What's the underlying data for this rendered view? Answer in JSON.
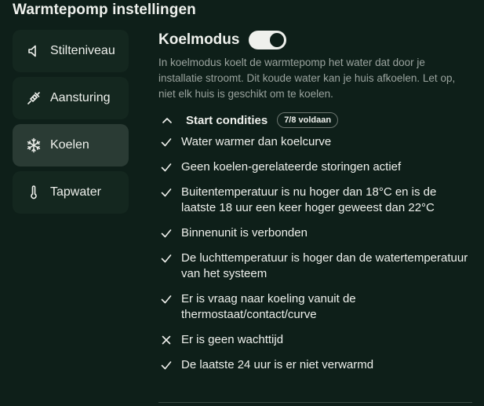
{
  "page": {
    "title": "Warmtepomp instellingen"
  },
  "sidebar": {
    "items": [
      {
        "label": "Stilteniveau",
        "icon": "speaker-icon",
        "active": false
      },
      {
        "label": "Aansturing",
        "icon": "plug-icon",
        "active": false
      },
      {
        "label": "Koelen",
        "icon": "snowflake-icon",
        "active": true
      },
      {
        "label": "Tapwater",
        "icon": "thermometer-icon",
        "active": false
      }
    ]
  },
  "mode": {
    "title": "Koelmodus",
    "toggle_on": true,
    "description": "In koelmodus koelt de warmtepomp het water dat door je installatie stroomt. Dit koude water kan je huis afkoelen. Let op, niet elk huis is geschikt om te koelen."
  },
  "conditions": {
    "title": "Start condities",
    "badge": "7/8 voldaan",
    "expanded": true,
    "items": [
      {
        "text": "Water warmer dan koelcurve",
        "met": true
      },
      {
        "text": "Geen koelen-gerelateerde storingen actief",
        "met": true
      },
      {
        "text": "Buitentemperatuur is nu hoger dan 18°C en is de laatste 18 uur een keer hoger geweest dan 22°C",
        "met": true
      },
      {
        "text": "Binnenunit is verbonden",
        "met": true
      },
      {
        "text": "De luchttemperatuur is hoger dan de watertemperatuur van het systeem",
        "met": true
      },
      {
        "text": "Er is vraag naar koeling vanuit de thermostaat/contact/curve",
        "met": true
      },
      {
        "text": "Er is geen wachttijd",
        "met": false
      },
      {
        "text": "De laatste 24 uur is er niet verwarmd",
        "met": true
      }
    ]
  },
  "colors": {
    "background": "#0e1f19",
    "nav_bg": "#14271f",
    "nav_active": "#2a3b34",
    "text": "#eef0ec",
    "muted": "#9aa39e"
  }
}
